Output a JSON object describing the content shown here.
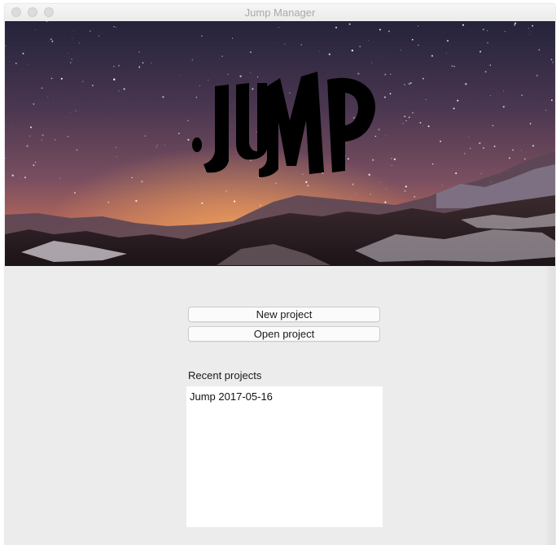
{
  "window": {
    "title": "Jump Manager"
  },
  "banner": {
    "logo_text": "JUMP",
    "image": "starry-night-desert-photo"
  },
  "actions": {
    "new_project_label": "New project",
    "open_project_label": "Open project"
  },
  "recent": {
    "label": "Recent projects",
    "items": [
      "Jump 2017-05-16"
    ]
  },
  "colors": {
    "window_bg": "#ececec",
    "title_text": "#a9a9a9",
    "sky_top": "#2a2740",
    "sky_glow": "#e0884a"
  }
}
